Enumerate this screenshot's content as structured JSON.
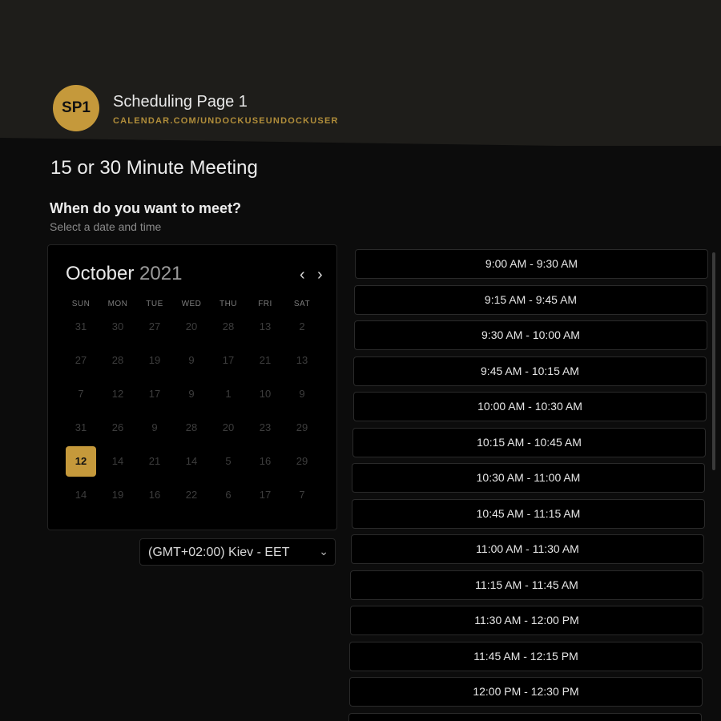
{
  "header": {
    "avatar_initials": "SP1",
    "page_name": "Scheduling Page 1",
    "page_url": "CALENDAR.COM/UNDOCKUSEUNDOCKUSER"
  },
  "meeting": {
    "title": "15 or 30 Minute Meeting",
    "prompt": "When do you want to meet?",
    "prompt_sub": "Select a date and time"
  },
  "calendar": {
    "month": "October",
    "year": "2021",
    "prev_icon": "chevron-left-icon",
    "next_icon": "chevron-right-icon",
    "weekdays": [
      "SUN",
      "MON",
      "TUE",
      "WED",
      "THU",
      "FRI",
      "SAT"
    ],
    "weeks": [
      [
        "31",
        "30",
        "27",
        "20",
        "28",
        "13",
        "2"
      ],
      [
        "27",
        "28",
        "19",
        "9",
        "17",
        "21",
        "13"
      ],
      [
        "7",
        "12",
        "17",
        "9",
        "1",
        "10",
        "9"
      ],
      [
        "31",
        "26",
        "9",
        "28",
        "20",
        "23",
        "29"
      ],
      [
        "12",
        "14",
        "21",
        "14",
        "5",
        "16",
        "29"
      ],
      [
        "14",
        "19",
        "16",
        "22",
        "6",
        "17",
        "7"
      ]
    ],
    "selected_day": "12"
  },
  "timezone": {
    "label": "(GMT+02:00) Kiev - EET",
    "icon": "chevron-down-icon"
  },
  "slots": [
    "9:00 AM - 9:30 AM",
    "9:15 AM - 9:45 AM",
    "9:30 AM - 10:00 AM",
    "9:45 AM - 10:15 AM",
    "10:00 AM - 10:30 AM",
    "10:15 AM - 10:45 AM",
    "10:30 AM - 11:00 AM",
    "10:45 AM - 11:15 AM",
    "11:00 AM - 11:30 AM",
    "11:15 AM - 11:45 AM",
    "11:30 AM - 12:00 PM",
    "11:45 AM - 12:15 PM",
    "12:00 PM - 12:30 PM",
    ""
  ],
  "colors": {
    "accent": "#c5993b",
    "background": "#0c0c0c",
    "header_bg": "#1e1d1a"
  }
}
